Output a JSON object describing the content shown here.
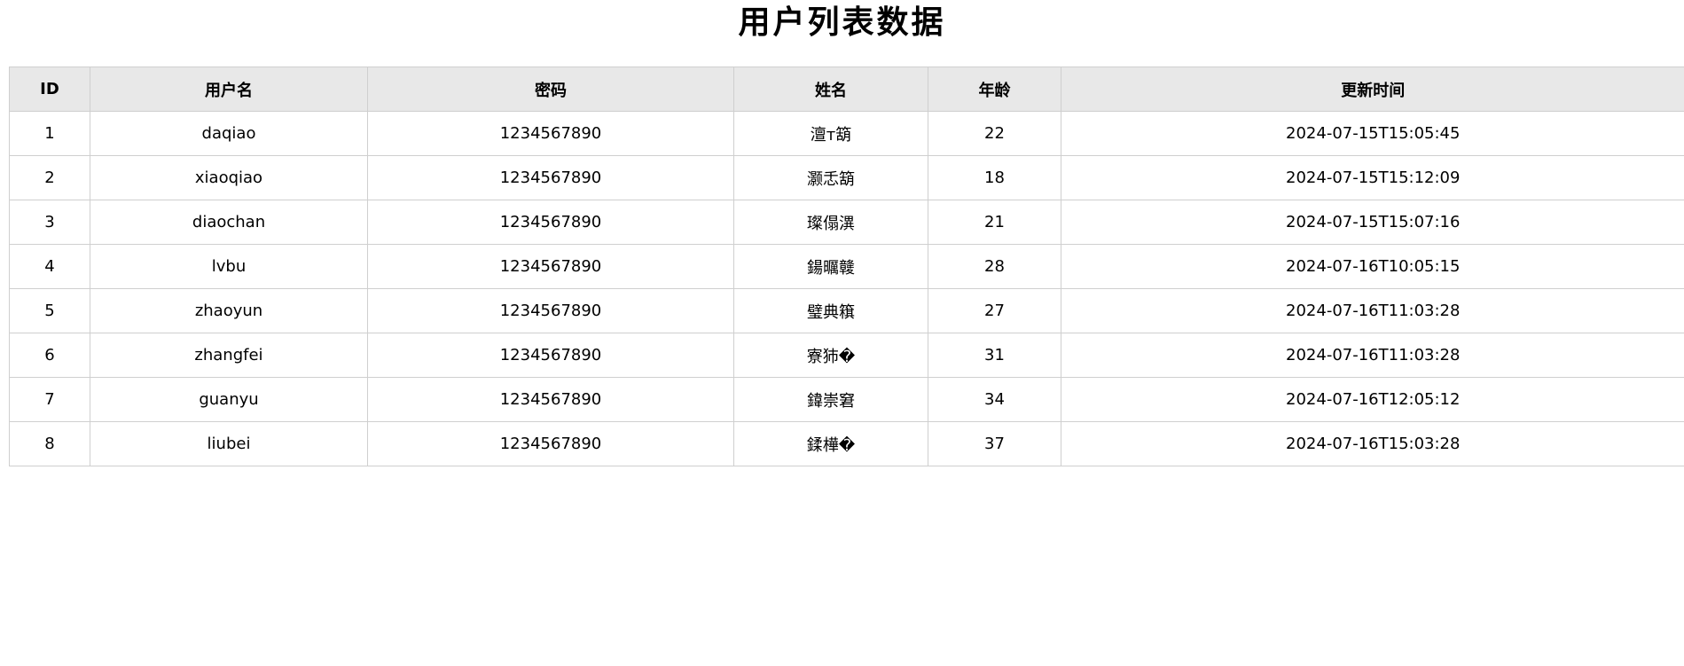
{
  "page": {
    "title": "用户列表数据"
  },
  "table": {
    "columns": [
      "ID",
      "用户名",
      "密码",
      "姓名",
      "年龄",
      "更新时间"
    ],
    "rows": [
      [
        "1",
        "daqiao",
        "1234567890",
        "澶т箶",
        "22",
        "2024-07-15T15:05:45"
      ],
      [
        "2",
        "xiaoqiao",
        "1234567890",
        "灏忎箶",
        "18",
        "2024-07-15T15:12:09"
      ],
      [
        "3",
        "diaochan",
        "1234567890",
        "璨傝潩",
        "21",
        "2024-07-15T15:07:16"
      ],
      [
        "4",
        "lvbu",
        "1234567890",
        "鍚曞竷",
        "28",
        "2024-07-16T10:05:15"
      ],
      [
        "5",
        "zhaoyun",
        "1234567890",
        "璧典簯",
        "27",
        "2024-07-16T11:03:28"
      ],
      [
        "6",
        "zhangfei",
        "1234567890",
        "寮犻�",
        "31",
        "2024-07-16T11:03:28"
      ],
      [
        "7",
        "guanyu",
        "1234567890",
        "鍏崇窘",
        "34",
        "2024-07-16T12:05:12"
      ],
      [
        "8",
        "liubei",
        "1234567890",
        "鍒樺�",
        "37",
        "2024-07-16T15:03:28"
      ]
    ]
  },
  "colors": {
    "header_bg": "#e8e8e8",
    "border": "#cfcfcf",
    "background": "#ffffff",
    "text": "#000000"
  }
}
